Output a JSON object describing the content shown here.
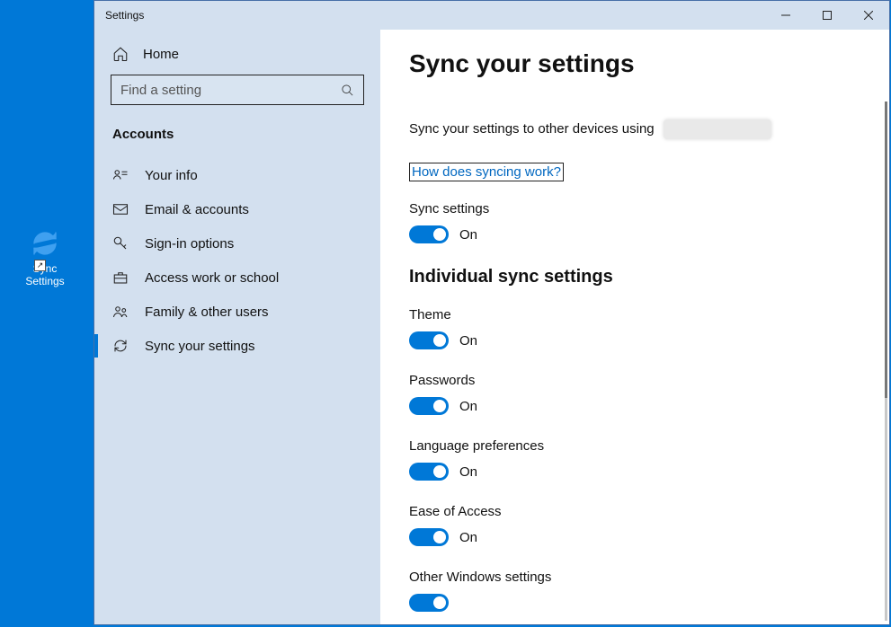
{
  "desktop": {
    "icon_label": "Sync Settings"
  },
  "window": {
    "title": "Settings"
  },
  "sidebar": {
    "home": "Home",
    "search_placeholder": "Find a setting",
    "section": "Accounts",
    "items": [
      {
        "label": "Your info"
      },
      {
        "label": "Email & accounts"
      },
      {
        "label": "Sign-in options"
      },
      {
        "label": "Access work or school"
      },
      {
        "label": "Family & other users"
      },
      {
        "label": "Sync your settings"
      }
    ]
  },
  "main": {
    "heading": "Sync your settings",
    "description": "Sync your settings to other devices using",
    "help_link": "How does syncing work?",
    "master": {
      "label": "Sync settings",
      "state": "On"
    },
    "subheading": "Individual sync settings",
    "toggles": [
      {
        "label": "Theme",
        "state": "On"
      },
      {
        "label": "Passwords",
        "state": "On"
      },
      {
        "label": "Language preferences",
        "state": "On"
      },
      {
        "label": "Ease of Access",
        "state": "On"
      },
      {
        "label": "Other Windows settings",
        "state": ""
      }
    ]
  }
}
